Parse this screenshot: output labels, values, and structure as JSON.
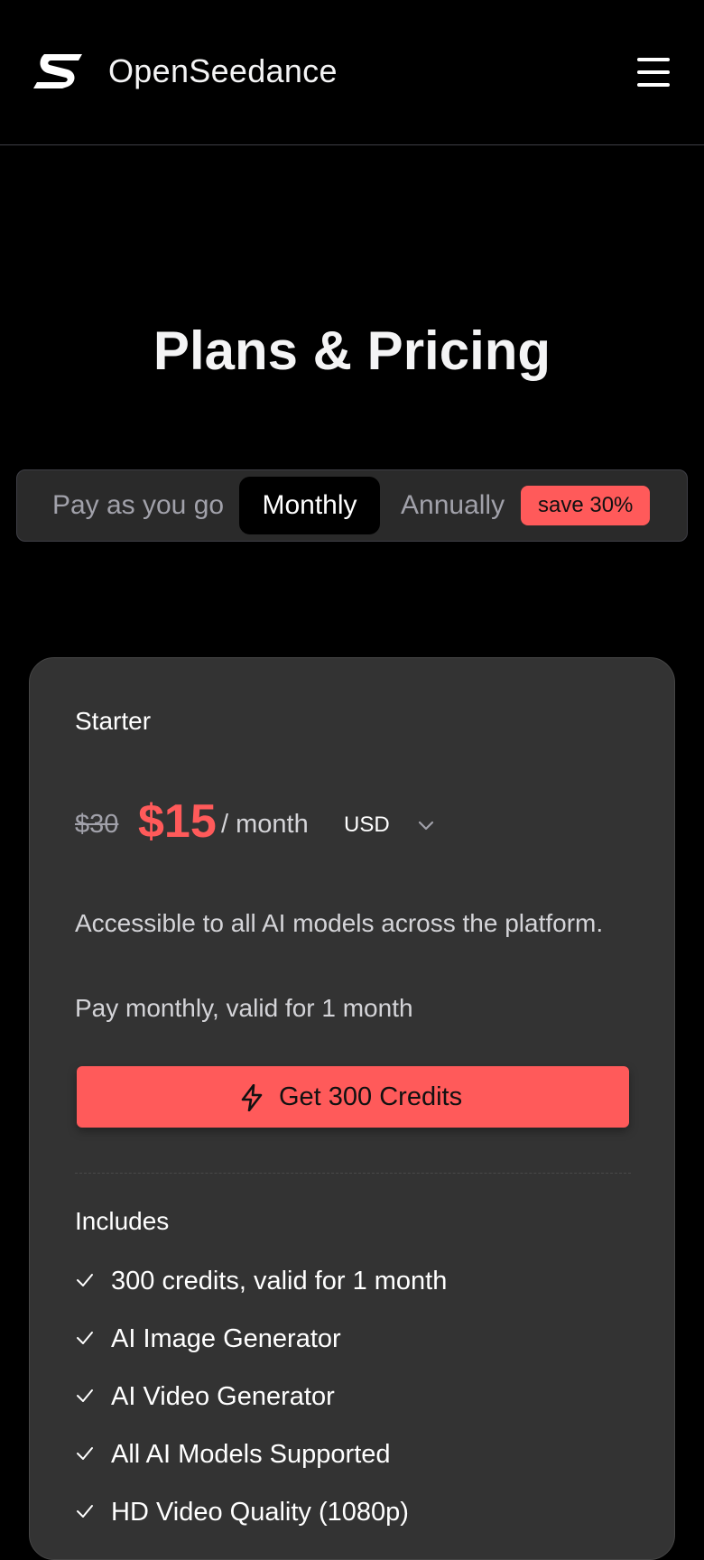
{
  "header": {
    "brand": "OpenSeedance",
    "logo_icon": "s-logo-icon",
    "menu_icon": "hamburger-menu-icon"
  },
  "page": {
    "title": "Plans & Pricing"
  },
  "billing_toggle": {
    "options": [
      {
        "label": "Pay as you go",
        "selected": false
      },
      {
        "label": "Monthly",
        "selected": true
      },
      {
        "label": "Annually",
        "selected": false
      }
    ],
    "badge": "save 30%"
  },
  "plan": {
    "name": "Starter",
    "original_price": "$30",
    "price": "$15",
    "period": "/ month",
    "currency": "USD",
    "description": "Accessible to all AI models across the platform.",
    "validity": "Pay monthly, valid for 1 month",
    "cta_label": "Get 300 Credits",
    "cta_icon": "lightning-bolt-icon",
    "includes_heading": "Includes",
    "features": [
      "300 credits, valid for 1 month",
      "AI Image Generator",
      "AI Video Generator",
      "All AI Models Supported",
      "HD Video Quality (1080p)"
    ]
  },
  "colors": {
    "background": "#000000",
    "card": "#333333",
    "accent": "#ff5a5a",
    "toggle_bg": "#2a2a2a"
  }
}
